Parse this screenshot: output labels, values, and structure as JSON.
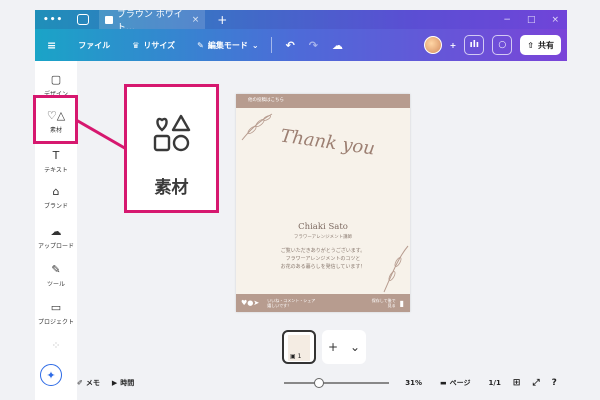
{
  "browser": {
    "dots": "•••",
    "tab_label": "ブラウン ホワイト…",
    "tab_close": "×",
    "new_tab": "+",
    "window_controls": [
      "−",
      "□",
      "×"
    ]
  },
  "toolbar": {
    "menu_icon": "≡",
    "file": "ファイル",
    "resize": "リサイズ",
    "edit_mode": "編集モード",
    "share": "共有"
  },
  "sidebar": [
    {
      "icon": "design-icon",
      "label": "デザイン"
    },
    {
      "icon": "elements-icon",
      "label": "素材"
    },
    {
      "icon": "text-icon",
      "label": "テキスト"
    },
    {
      "icon": "brand-icon",
      "label": "ブランド"
    },
    {
      "icon": "upload-icon",
      "label": "アップロード"
    },
    {
      "icon": "tools-icon",
      "label": "ツール"
    },
    {
      "icon": "projects-icon",
      "label": "プロジェクト"
    }
  ],
  "highlight": {
    "label": "素材"
  },
  "card": {
    "header": "他の投稿はこちら",
    "thanks": "Thank you",
    "name": "Chiaki Sato",
    "role": "フラワーアレンジメント講師",
    "message_lines": [
      "ご覧いただきありがとうございます。",
      "フラワーアレンジメントのコツと",
      "お花のある暮らしを発信しています！"
    ],
    "footer_left": "いいね・コメント・シェア",
    "footer_left2": "嬉しいです！",
    "footer_right": "保存して後で",
    "footer_right2": "見る"
  },
  "pages": {
    "thumb_number": "1",
    "add": "+",
    "more": "⌄"
  },
  "bottombar": {
    "memo": "メモ",
    "time": "時間",
    "zoom": "31%",
    "zoom_fraction": 0.31,
    "page_label": "ページ",
    "page_count": "1/1"
  }
}
